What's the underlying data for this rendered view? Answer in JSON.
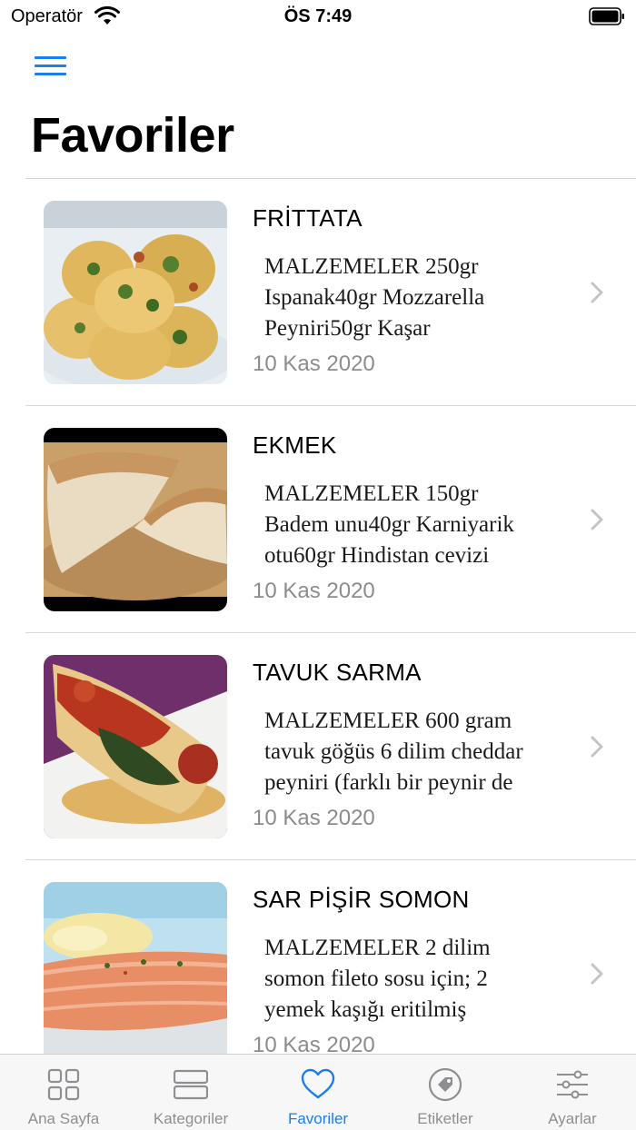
{
  "status_bar": {
    "carrier": "Operatör",
    "time": "ÖS 7:49"
  },
  "header": {
    "title": "Favoriler"
  },
  "recipes": [
    {
      "title": "FRİTTATA",
      "desc_lines": [
        "MALZEMELER 250gr",
        "Ispanak40gr Mozzarella",
        "Peyniri50gr Kaşar"
      ],
      "date": "10 Kas 2020",
      "image": "frittata-photo"
    },
    {
      "title": "EKMEK",
      "desc_lines": [
        "MALZEMELER 150gr",
        "Badem unu40gr Karniyarik",
        "otu60gr Hindistan cevizi"
      ],
      "date": "10 Kas 2020",
      "image": "bread-photo"
    },
    {
      "title": "TAVUK SARMA",
      "desc_lines": [
        "MALZEMELER 600 gram",
        "tavuk göğüs 6 dilim cheddar",
        "peyniri (farklı bir peynir de"
      ],
      "date": "10 Kas 2020",
      "image": "chicken-roll-photo"
    },
    {
      "title": "SAR PİŞİR SOMON",
      "desc_lines": [
        "MALZEMELER 2 dilim",
        "somon fileto sosu için; 2",
        "yemek kaşığı eritilmiş"
      ],
      "date": "10 Kas 2020",
      "image": "salmon-photo"
    }
  ],
  "tab_bar": {
    "tabs": [
      {
        "label": "Ana Sayfa",
        "icon": "grid-icon",
        "active": false
      },
      {
        "label": "Kategoriler",
        "icon": "categories-icon",
        "active": false
      },
      {
        "label": "Favoriler",
        "icon": "heart-icon",
        "active": true
      },
      {
        "label": "Etiketler",
        "icon": "tag-icon",
        "active": false
      },
      {
        "label": "Ayarlar",
        "icon": "sliders-icon",
        "active": false
      }
    ]
  },
  "colors": {
    "accent": "#1a7ef0",
    "inactive": "#8e8e93",
    "secondary_text": "#8c8c8c",
    "separator": "#d8d8d8"
  }
}
